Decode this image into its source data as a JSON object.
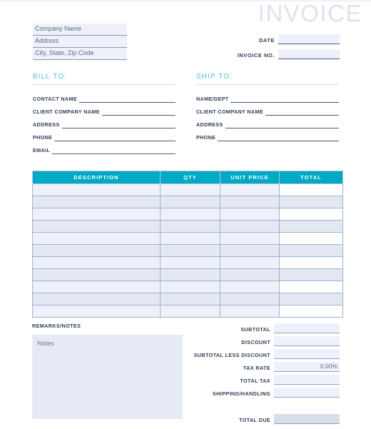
{
  "document": {
    "title": "INVOICE"
  },
  "company": {
    "lines": [
      "Company Name",
      "Address",
      "City, State, Zip Code"
    ]
  },
  "meta": {
    "rows": [
      {
        "label": "DATE",
        "value": ""
      },
      {
        "label": "INVOICE NO.",
        "value": ""
      }
    ]
  },
  "bill_to": {
    "heading": "BILL TO:",
    "fields": [
      {
        "label": "CONTACT NAME",
        "value": ""
      },
      {
        "label": "CLIENT COMPANY NAME",
        "value": ""
      },
      {
        "label": "ADDRESS",
        "value": ""
      },
      {
        "label": "PHONE",
        "value": ""
      },
      {
        "label": "EMAIL",
        "value": ""
      }
    ]
  },
  "ship_to": {
    "heading": "SHIP TO:",
    "fields": [
      {
        "label": "NAME/DEPT",
        "value": ""
      },
      {
        "label": "CLIENT COMPANY NAME",
        "value": ""
      },
      {
        "label": "ADDRESS",
        "value": ""
      },
      {
        "label": "PHONE",
        "value": ""
      }
    ]
  },
  "items_table": {
    "headers": [
      "DESCRIPTION",
      "QTY",
      "UNIT PRICE",
      "TOTAL"
    ],
    "row_count": 11,
    "rows": [
      {
        "description": "",
        "qty": "",
        "unit_price": "",
        "total": ""
      },
      {
        "description": "",
        "qty": "",
        "unit_price": "",
        "total": ""
      },
      {
        "description": "",
        "qty": "",
        "unit_price": "",
        "total": ""
      },
      {
        "description": "",
        "qty": "",
        "unit_price": "",
        "total": ""
      },
      {
        "description": "",
        "qty": "",
        "unit_price": "",
        "total": ""
      },
      {
        "description": "",
        "qty": "",
        "unit_price": "",
        "total": ""
      },
      {
        "description": "",
        "qty": "",
        "unit_price": "",
        "total": ""
      },
      {
        "description": "",
        "qty": "",
        "unit_price": "",
        "total": ""
      },
      {
        "description": "",
        "qty": "",
        "unit_price": "",
        "total": ""
      },
      {
        "description": "",
        "qty": "",
        "unit_price": "",
        "total": ""
      },
      {
        "description": "",
        "qty": "",
        "unit_price": "",
        "total": ""
      }
    ]
  },
  "remarks": {
    "title": "REMARKS/NOTES",
    "placeholder": "Notes",
    "value": ""
  },
  "summary": {
    "rows": [
      {
        "label": "SUBTOTAL",
        "value": ""
      },
      {
        "label": "DISCOUNT",
        "value": ""
      },
      {
        "label": "SUBTOTAL LESS DISCOUNT",
        "value": ""
      },
      {
        "label": "TAX RATE",
        "value": "0.00%"
      },
      {
        "label": "TOTAL TAX",
        "value": ""
      },
      {
        "label": "SHIPPING/HANDLING",
        "value": ""
      }
    ],
    "total_due": {
      "label": "TOTAL DUE",
      "value": ""
    }
  },
  "colors": {
    "table_header": "#00a9c4",
    "section_heading": "#4ec3e0",
    "title": "#dde2ee",
    "field_fill": "#eef1fa",
    "row_alt": "#e3e8f2",
    "total_due_fill": "#d7dde9",
    "label_text": "#2e3c54"
  }
}
